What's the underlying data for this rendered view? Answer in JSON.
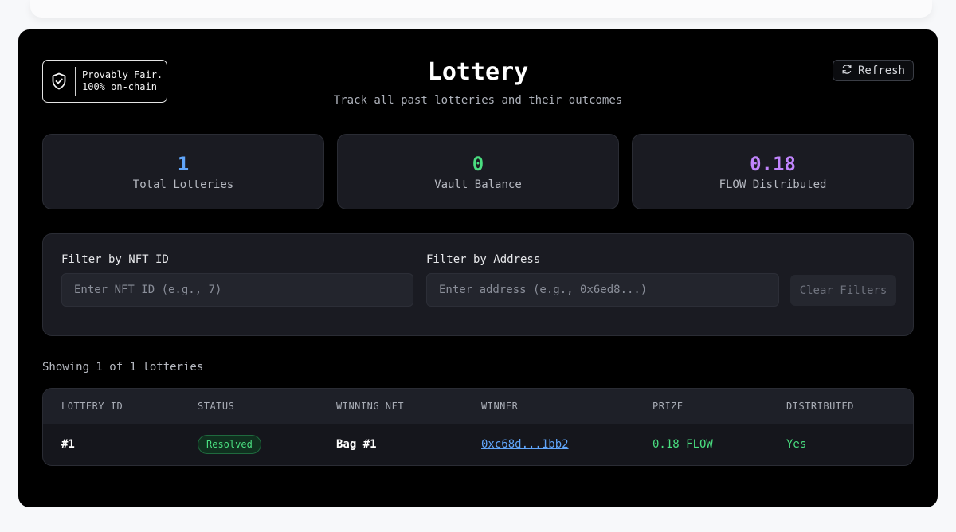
{
  "header": {
    "badge_line1": "Provably Fair.",
    "badge_line2": "100% on-chain",
    "title": "Lottery",
    "subtitle": "Track all past lotteries and their outcomes",
    "refresh_label": "Refresh"
  },
  "stats": [
    {
      "value": "1",
      "label": "Total Lotteries",
      "color": "#60a5fa"
    },
    {
      "value": "0",
      "label": "Vault Balance",
      "color": "#4ade80"
    },
    {
      "value": "0.18",
      "label": "FLOW Distributed",
      "color": "#c084fc"
    }
  ],
  "filters": {
    "nft_label": "Filter by NFT ID",
    "nft_placeholder": "Enter NFT ID (e.g., 7)",
    "address_label": "Filter by Address",
    "address_placeholder": "Enter address (e.g., 0x6ed8...)",
    "clear_label": "Clear Filters"
  },
  "showing_text": "Showing 1 of 1 lotteries",
  "table": {
    "headers": [
      "LOTTERY ID",
      "STATUS",
      "WINNING NFT",
      "WINNER",
      "PRIZE",
      "DISTRIBUTED"
    ],
    "rows": [
      {
        "id": "#1",
        "status": "Resolved",
        "nft": "Bag #1",
        "winner": "0xc68d...1bb2",
        "prize": "0.18 FLOW",
        "distributed": "Yes"
      }
    ]
  }
}
